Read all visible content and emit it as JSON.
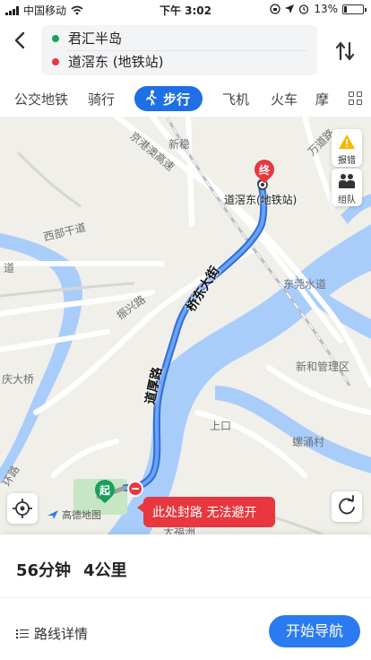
{
  "status_bar": {
    "carrier": "中国移动",
    "time": "下午 3:02",
    "battery": "13%"
  },
  "route": {
    "origin": "君汇半岛",
    "destination": "道滘东 (地铁站)",
    "origin_color": "#18a058",
    "destination_color": "#e8373e"
  },
  "tabs": {
    "items": [
      "公交地铁",
      "骑行",
      "步行",
      "飞机",
      "火车",
      "摩"
    ],
    "active": "步行"
  },
  "map": {
    "labels": {
      "xinwen": "新稳",
      "wanfang": "万道路",
      "jinggang": "京港澳高速",
      "xibu": "西部干道",
      "dao": "道",
      "zhenxing": "振兴路",
      "dongguan": "东莞水道",
      "xinhe": "新和管理区",
      "qingda": "庆大桥",
      "shangkou": "上口",
      "luoyong": "螺涌村",
      "huanlu": "环路",
      "dafu": "大福洲"
    },
    "road_labels": {
      "qiaodong": "桥东大街",
      "daohou": "道厚路"
    },
    "station": "道滘东(地铁站)",
    "end_marker": "终",
    "start_marker": "起",
    "report_button": "报错",
    "team_button": "组队",
    "logo_text": "高德地图",
    "closure_notice": "此处封路 无法避开",
    "route_color": "#3b82f6"
  },
  "summary": {
    "duration": "56分钟",
    "distance": "4公里"
  },
  "actions": {
    "details": "路线详情",
    "start_navigation": "开始导航"
  }
}
